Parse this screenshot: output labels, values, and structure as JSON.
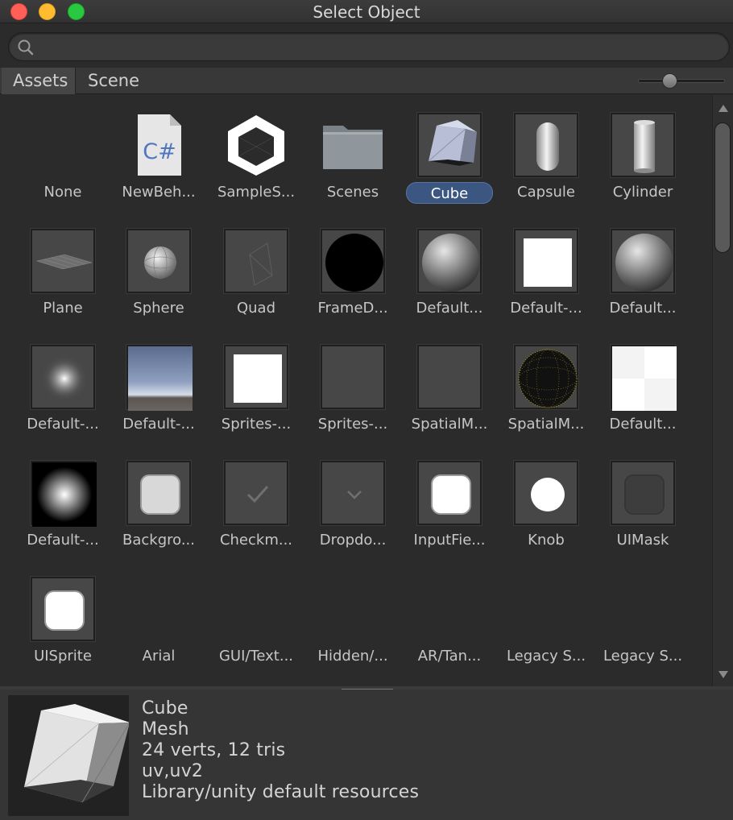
{
  "window": {
    "title": "Select Object"
  },
  "search": {
    "placeholder": "",
    "value": ""
  },
  "tabs": [
    {
      "label": "Assets"
    },
    {
      "label": "Scene"
    }
  ],
  "selected_index": 4,
  "items": [
    {
      "label": "None",
      "icon": "none"
    },
    {
      "label": "NewBeh...",
      "icon": "csharp-script-icon",
      "glyph": "C#"
    },
    {
      "label": "SampleS...",
      "icon": "unity-scene-icon"
    },
    {
      "label": "Scenes",
      "icon": "folder-icon"
    },
    {
      "label": "Cube",
      "icon": "cube-mesh-icon"
    },
    {
      "label": "Capsule",
      "icon": "capsule-mesh-icon"
    },
    {
      "label": "Cylinder",
      "icon": "cylinder-mesh-icon"
    },
    {
      "label": "Plane",
      "icon": "plane-mesh-icon"
    },
    {
      "label": "Sphere",
      "icon": "sphere-mesh-icon"
    },
    {
      "label": "Quad",
      "icon": "quad-mesh-icon"
    },
    {
      "label": "FrameD...",
      "icon": "black-circle-icon"
    },
    {
      "label": "Default...",
      "icon": "material-sphere-icon"
    },
    {
      "label": "Default-...",
      "icon": "white-square-icon"
    },
    {
      "label": "Default...",
      "icon": "material-sphere-icon"
    },
    {
      "label": "Default-...",
      "icon": "radial-glow-icon"
    },
    {
      "label": "Default-...",
      "icon": "skybox-icon"
    },
    {
      "label": "Sprites-...",
      "icon": "white-square-icon"
    },
    {
      "label": "Sprites-...",
      "icon": "blank-material-icon"
    },
    {
      "label": "SpatialM...",
      "icon": "blank-material-icon"
    },
    {
      "label": "SpatialM...",
      "icon": "wireframe-sphere-icon"
    },
    {
      "label": "Default...",
      "icon": "checker-icon"
    },
    {
      "label": "Default-...",
      "icon": "particle-glow-icon"
    },
    {
      "label": "Backgro...",
      "icon": "rounded-sprite-icon"
    },
    {
      "label": "Checkm...",
      "icon": "checkmark-icon"
    },
    {
      "label": "Dropdo...",
      "icon": "chevron-down-icon"
    },
    {
      "label": "InputFie...",
      "icon": "rounded-sprite-white-icon"
    },
    {
      "label": "Knob",
      "icon": "knob-icon"
    },
    {
      "label": "UIMask",
      "icon": "ui-mask-icon"
    },
    {
      "label": "UISprite",
      "icon": "rounded-sprite-white-icon"
    },
    {
      "label": "Arial",
      "icon": "none"
    },
    {
      "label": "GUI/Text...",
      "icon": "none"
    },
    {
      "label": "Hidden/...",
      "icon": "none"
    },
    {
      "label": "AR/Tan...",
      "icon": "none"
    },
    {
      "label": "Legacy S...",
      "icon": "none"
    },
    {
      "label": "Legacy S...",
      "icon": "none"
    }
  ],
  "preview": {
    "icon": "cube-preview-icon",
    "lines": [
      "Cube",
      "Mesh",
      "24 verts, 12 tris",
      "uv,uv2",
      "Library/unity default resources"
    ]
  },
  "colors": {
    "selection": "#3b5781",
    "background": "#2b2b2b",
    "panel": "#353535"
  }
}
